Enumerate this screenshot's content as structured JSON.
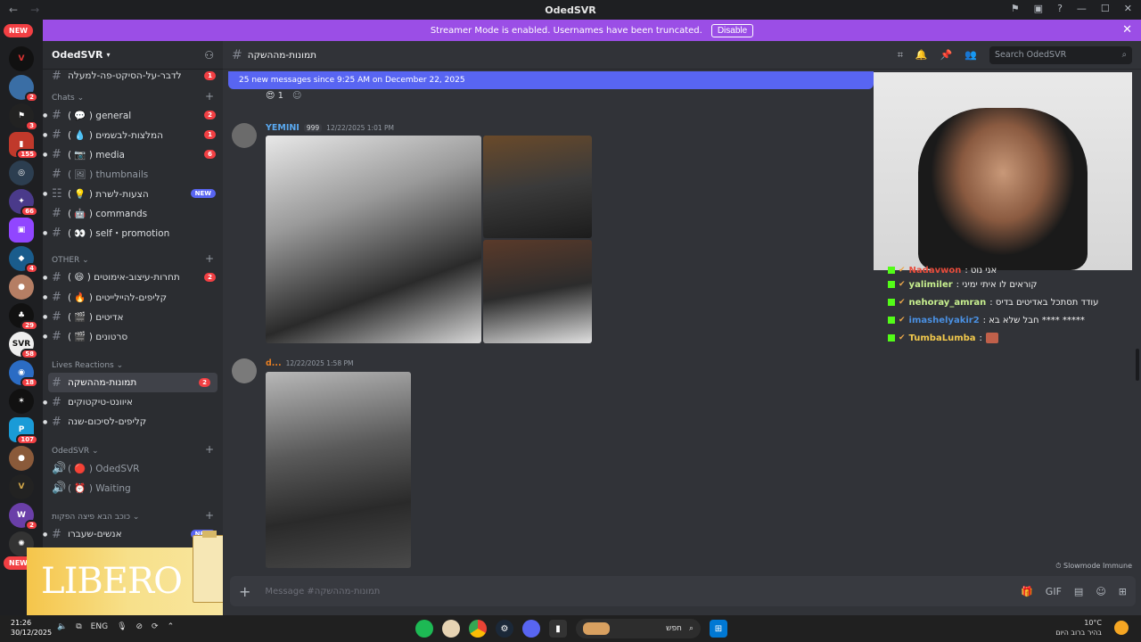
{
  "window": {
    "title": "OdedSVR"
  },
  "streamer_bar": {
    "text": "Streamer Mode is enabled. Usernames have been truncated.",
    "disable_label": "Disable",
    "color": "#9b4ee6"
  },
  "server_rail": {
    "new_label_top": "NEW",
    "new_label_bottom": "NEW",
    "badges": [
      "2",
      "3",
      "155",
      "66",
      "4",
      "29",
      "58",
      "18",
      "107",
      "2"
    ]
  },
  "server": {
    "name": "OdedSVR"
  },
  "channels": {
    "top": {
      "name": "לדבר-על-הסיקט-פה-למעלה",
      "badge": "1"
    },
    "cat_chats": "Chats",
    "chats": [
      {
        "name": "( 💬 ) general",
        "badge": "2"
      },
      {
        "name": "( 💧 ) המלצות-לבשמים",
        "badge": "1"
      },
      {
        "name": "( 📷 ) media",
        "badge": "6"
      },
      {
        "name": "( 🖼 ) thumbnails",
        "badge": ""
      },
      {
        "name": "( 💡 ) הצעות-לשרת",
        "badge": "NEW"
      },
      {
        "name": "( 🤖 ) commands",
        "badge": ""
      },
      {
        "name": "( 👀 ) self・promotion",
        "badge": ""
      }
    ],
    "cat_other": "OTHER",
    "other": [
      {
        "name": "( 😄 ) תחרות-עיצוב-אימוטים",
        "badge": "2"
      },
      {
        "name": "( 🔥 ) קליפים-להיילייטים",
        "badge": ""
      },
      {
        "name": "( 🎬 ) אדיטים",
        "badge": ""
      },
      {
        "name": "( 🎬 ) סרטונים",
        "badge": ""
      }
    ],
    "cat_lives": "Lives Reactions",
    "lives": [
      {
        "name": "תמונות-מההשקה",
        "badge": "2"
      },
      {
        "name": "איוונט-טיקטוקים",
        "badge": ""
      },
      {
        "name": "קליפים-לסיכום-שנה",
        "badge": ""
      }
    ],
    "cat_voice": "OdedSVR",
    "voice": [
      {
        "name": "( 🔴 ) OdedSVR"
      },
      {
        "name": "( ⏰ ) Waiting"
      }
    ],
    "cat_last": "כוכב הבא פיצה הפקות",
    "last": {
      "name": "אנשים-שעברו",
      "badge": "NEW"
    }
  },
  "promo": {
    "text": "LIBERO"
  },
  "header": {
    "channel": "תמונות-מההשקה",
    "search_placeholder": "Search OdedSVR"
  },
  "new_messages_banner": "25 new messages since 9:25 AM on December 22, 2025",
  "reaction": {
    "emoji": "😍",
    "count": "1"
  },
  "messages": [
    {
      "user": "YEMINI",
      "tag": "999",
      "time": "12/22/2025 1:01 PM"
    },
    {
      "user": "d...",
      "time": "12/22/2025 1:58 PM"
    }
  ],
  "stream_chat": [
    {
      "user": "Nadavwon",
      "text": ": אני נוט",
      "color": "#e74c3c"
    },
    {
      "user": "yalimiler",
      "text": ": קוראים לו איתי ימיני",
      "color": "#c8f08f"
    },
    {
      "user": "nehoray_amran",
      "text": ": עודד תסתכל באדיטים בדיס",
      "color": "#c8f08f"
    },
    {
      "user": "imashelyakir2",
      "text": ": חבל שלא בא **** *****",
      "color": "#4a90e2"
    },
    {
      "user": "TumbaLumba",
      "text": ":",
      "color": "#f2c94c"
    }
  ],
  "slowmode": "Slowmode Immune",
  "composer": {
    "placeholder": "Message #תמונות-מההשקה"
  },
  "taskbar": {
    "time": "21:26",
    "date": "30/12/2025",
    "lang": "ENG",
    "search_placeholder": "חפש",
    "temp": "10°C",
    "weather": "בהיר ברוב היום"
  }
}
